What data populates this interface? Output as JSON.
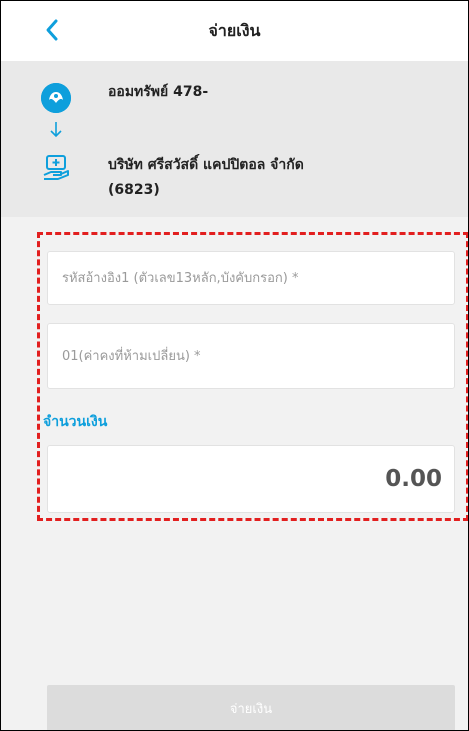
{
  "header": {
    "title": "จ่ายเงิน",
    "back_icon": "chevron-left-icon"
  },
  "transfer": {
    "from_label": "ออมทรัพย์ 478-",
    "to_label_line1": "บริษัท ศรีสวัสดิ์ แคปปิตอล จำกัด",
    "to_label_line2": "(6823)"
  },
  "form": {
    "ref1_placeholder": "รหัสอ้างอิง1 (ตัวเลข13หลัก,บังคับกรอก) *",
    "ref2_placeholder": "01(ค่าคงที่ห้ามเปลี่ยน) *",
    "amount_label": "จำนวนเงิน",
    "amount_value": "0.00"
  },
  "actions": {
    "pay_label": "จ่ายเงิน"
  },
  "colors": {
    "accent": "#0e9fdc",
    "highlight": "#e21f1f",
    "button_disabled": "#dcdcdc"
  }
}
